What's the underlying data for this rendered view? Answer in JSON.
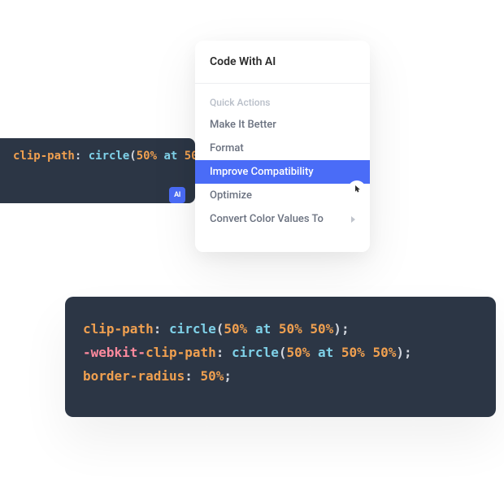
{
  "code_top": {
    "line1": {
      "prop": "clip-path",
      "colon": ": ",
      "func": "circle",
      "open": "(",
      "arg_partial": "50%",
      "kw": " at ",
      "arg_partial2": "50"
    }
  },
  "ai_badge": {
    "label": "AI"
  },
  "popup": {
    "title": "Code With AI",
    "section": "Quick Actions",
    "items": {
      "make_better": "Make It Better",
      "format": "Format",
      "improve_compat": "Improve Compatibility",
      "optimize": "Optimize",
      "convert_color": "Convert Color Values To"
    }
  },
  "code_bottom": {
    "l1": {
      "prop": "clip-path",
      "colon": ": ",
      "func": "circle",
      "open": "(",
      "a": "50%",
      "kw1": " at ",
      "b": "50%",
      "sp": " ",
      "c": "50%",
      "close": ")",
      "semi": ";"
    },
    "l2": {
      "prefix": "-webkit-",
      "prop": "clip-path",
      "colon": ": ",
      "func": "circle",
      "open": "(",
      "a": "50%",
      "kw1": " at ",
      "b": "50%",
      "sp": " ",
      "c": "50%",
      "close": ")",
      "semi": ";"
    },
    "l3": {
      "prop": "border-radius",
      "colon": ": ",
      "a": "50%",
      "semi": ";"
    }
  }
}
